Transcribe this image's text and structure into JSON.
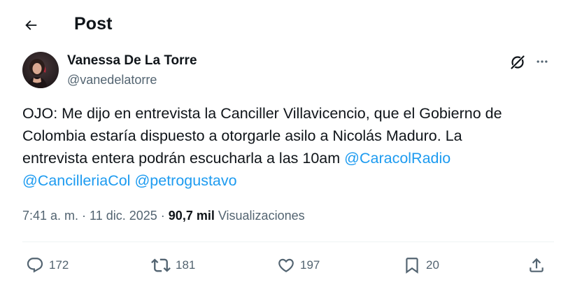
{
  "header": {
    "title": "Post",
    "back_icon": "arrow-left-icon"
  },
  "author": {
    "name": "Vanessa De La Torre",
    "handle": "@vanedelatorre",
    "avatar_icon": "profile-photo"
  },
  "tweet": {
    "lines": [
      [
        {
          "text": "OJO: Me dijo en entrevista la Canciller Villavicencio, que el Gobierno de",
          "mention": false
        }
      ],
      [
        {
          "text": "Colombia estaría dispuesto a otorgarle asilo a Nicolás Maduro. La",
          "mention": false
        }
      ],
      [
        {
          "text": "entrevista entera podrán escucharla a las 10am ",
          "mention": false
        },
        {
          "text": "@CaracolRadio",
          "mention": true
        }
      ],
      [
        {
          "text": "@CancilleriaCol",
          "mention": true
        },
        {
          "text": " ",
          "mention": false
        },
        {
          "text": "@petrogustavo",
          "mention": true
        }
      ]
    ]
  },
  "meta": {
    "time": "7:41 a. m.",
    "separator": " · ",
    "date": "11 dic. 2025",
    "views_count": "90,7 mil",
    "views_label": "Visualizaciones"
  },
  "actions": {
    "replies": "172",
    "reposts": "181",
    "likes": "197",
    "bookmarks": "20"
  },
  "colors": {
    "text": "#0f1419",
    "secondary": "#536471",
    "link": "#1d9bf0",
    "divider": "#eff3f4"
  }
}
